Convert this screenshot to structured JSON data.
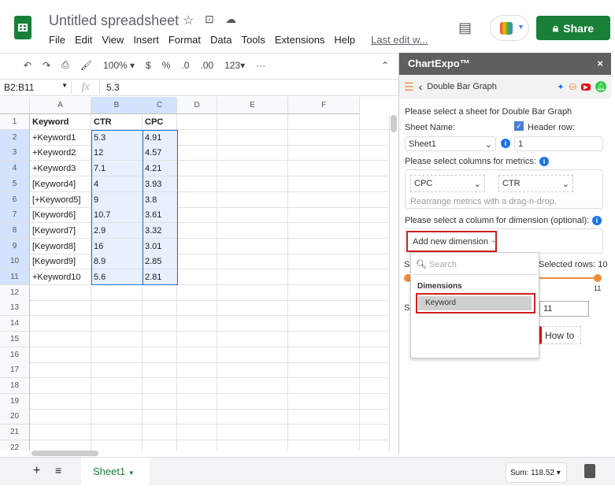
{
  "app": {
    "title": "Untitled spreadsheet",
    "menu": [
      "File",
      "Edit",
      "View",
      "Insert",
      "Format",
      "Data",
      "Tools",
      "Extensions",
      "Help",
      "Last edit w..."
    ],
    "share": "Share",
    "accent": "#188038"
  },
  "toolbar": {
    "zoom": "100%",
    "currency": "$",
    "percent": "%",
    "dec_less": ".0",
    "dec_more": ".00",
    "format": "123",
    "more": "···"
  },
  "formula": {
    "range": "B2:B11",
    "fx": "fx",
    "value": "5.3"
  },
  "columns": [
    "A",
    "B",
    "C",
    "D",
    "E",
    "F"
  ],
  "rows": [
    [
      "Keyword",
      "CTR",
      "CPC"
    ],
    [
      "+Keyword1",
      "5.3",
      "4.91"
    ],
    [
      "+Keyword2",
      "12",
      "4.57"
    ],
    [
      "+Keyword3",
      "7.1",
      "4.21"
    ],
    [
      "[Keyword4]",
      "4",
      "3.93"
    ],
    [
      "[+Keyword5]",
      "9",
      "3.8"
    ],
    [
      "[Keyword6]",
      "10.7",
      "3.61"
    ],
    [
      "[Keyword7]",
      "2.9",
      "3.32"
    ],
    [
      "[Keyword8]",
      "16",
      "3.01"
    ],
    [
      "[Keyword9]",
      "8.9",
      "2.85"
    ],
    [
      "+Keyword10",
      "5.6",
      "2.81"
    ]
  ],
  "row_count": 23,
  "panel": {
    "title": "ChartExpo™",
    "close": "×",
    "chart": "Double Bar Graph",
    "sheet_prompt": "Please select a sheet for Double Bar Graph",
    "sheet_label": "Sheet Name:",
    "sheet_value": "Sheet1",
    "header_label": "Header row:",
    "header_checked": true,
    "header_value": "1",
    "metrics_prompt": "Please select columns for metrics:",
    "metric1": "CPC",
    "metric2": "CTR",
    "rearrange": "Rearrange metrics with a drag-n-drop.",
    "dimension_prompt": "Please select a column for dimension (optional):",
    "add_dimension": "Add new dimension",
    "search_placeholder": "Search",
    "dimensions_header": "Dimensions",
    "dimension_option": "Keyword",
    "selected_rows": "Selected rows: 10",
    "slider_max": "11",
    "rows_end": "11",
    "howto": "How to",
    "s1": "S",
    "s2": "S",
    "slider_color": "#ef8c3a"
  },
  "bottom": {
    "sheet_tab": "Sheet1",
    "sum": "Sum: 118.52"
  }
}
